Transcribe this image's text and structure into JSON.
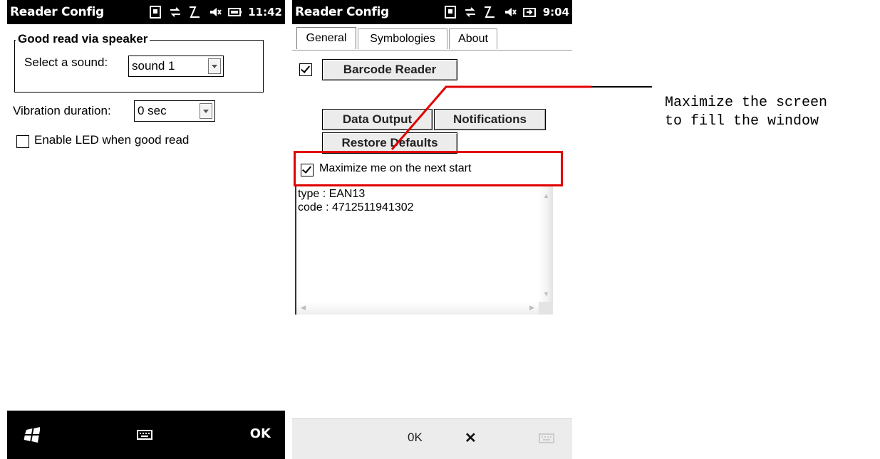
{
  "left_screen": {
    "title": "Reader Config",
    "clock": "11:42",
    "status_icons": [
      "sim-icon",
      "data-transfer-icon",
      "signal-icon",
      "speaker-muted-icon",
      "battery-icon"
    ],
    "group_title": "Good read via speaker",
    "sound_label": "Select a sound:",
    "sound_value": "sound 1",
    "vibration_label": "Vibration duration:",
    "vibration_value": "0 sec",
    "led_checkbox_label": "Enable LED when good read",
    "led_checked": false,
    "bottom_bar": {
      "start_icon": "windows-flag-icon",
      "keyboard_icon": "keyboard-icon",
      "ok_label": "OK"
    }
  },
  "right_screen": {
    "title": "Reader Config",
    "clock": "9:04",
    "status_icons": [
      "sim-icon",
      "data-transfer-icon",
      "signal-icon",
      "speaker-muted-icon",
      "power-plug-icon"
    ],
    "tabs": [
      {
        "label": "General",
        "active": true
      },
      {
        "label": "Symbologies",
        "active": false
      },
      {
        "label": "About",
        "active": false
      }
    ],
    "barcode_reader_checked": true,
    "barcode_reader_label": "Barcode Reader",
    "data_output_label": "Data Output",
    "notifications_label": "Notifications",
    "restore_defaults_label": "Restore Defaults",
    "maximize_checked": true,
    "maximize_label": "Maximize me on the next start",
    "output_lines": [
      "type : EAN13",
      "code : 4712511941302"
    ],
    "softkeys": {
      "ok_label": "0K",
      "close_label": "✕",
      "keyboard_icon": "keyboard-icon"
    }
  },
  "annotation": {
    "text_line1": "Maximize the screen",
    "text_line2": "to fill the window",
    "color": "#e00000"
  }
}
